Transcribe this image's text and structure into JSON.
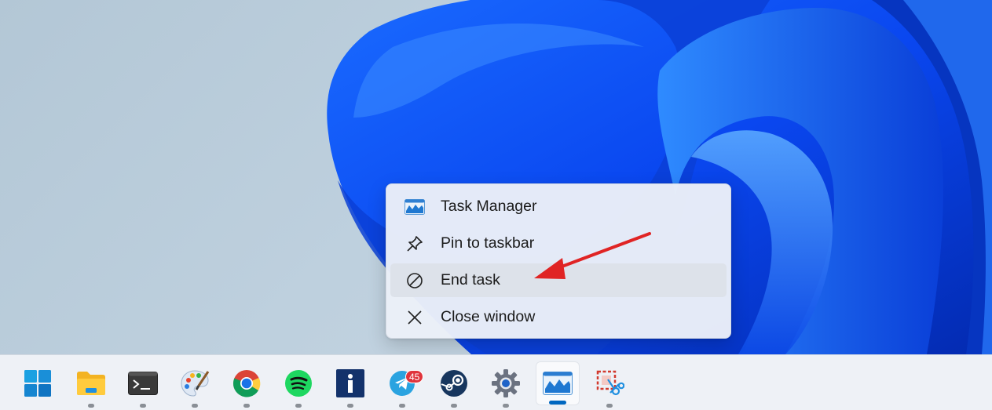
{
  "context_menu": {
    "items": [
      {
        "label": "Task Manager",
        "icon": "task-manager-icon"
      },
      {
        "label": "Pin to taskbar",
        "icon": "pin-icon"
      },
      {
        "label": "End task",
        "icon": "end-task-icon"
      },
      {
        "label": "Close window",
        "icon": "close-icon"
      }
    ],
    "highlighted_item": "End task"
  },
  "annotation": {
    "arrow_color": "#e02424"
  },
  "taskbar": {
    "items": [
      {
        "name": "start",
        "icon": "windows-start-icon"
      },
      {
        "name": "file-explorer",
        "icon": "folder-icon"
      },
      {
        "name": "terminal",
        "icon": "terminal-icon"
      },
      {
        "name": "paint",
        "icon": "paint-palette-icon"
      },
      {
        "name": "chrome",
        "icon": "chrome-icon"
      },
      {
        "name": "spotify",
        "icon": "spotify-icon"
      },
      {
        "name": "info-app",
        "icon": "info-icon"
      },
      {
        "name": "telegram",
        "icon": "telegram-icon",
        "badge": "45"
      },
      {
        "name": "steam",
        "icon": "steam-icon"
      },
      {
        "name": "settings",
        "icon": "gear-icon"
      },
      {
        "name": "task-manager",
        "icon": "task-manager-icon",
        "active": true
      },
      {
        "name": "snipping-tool",
        "icon": "snipping-tool-icon"
      }
    ]
  },
  "colors": {
    "accent": "#0067c0",
    "wallpaper_blue": "#0a4dff",
    "badge": "#e0343c"
  }
}
